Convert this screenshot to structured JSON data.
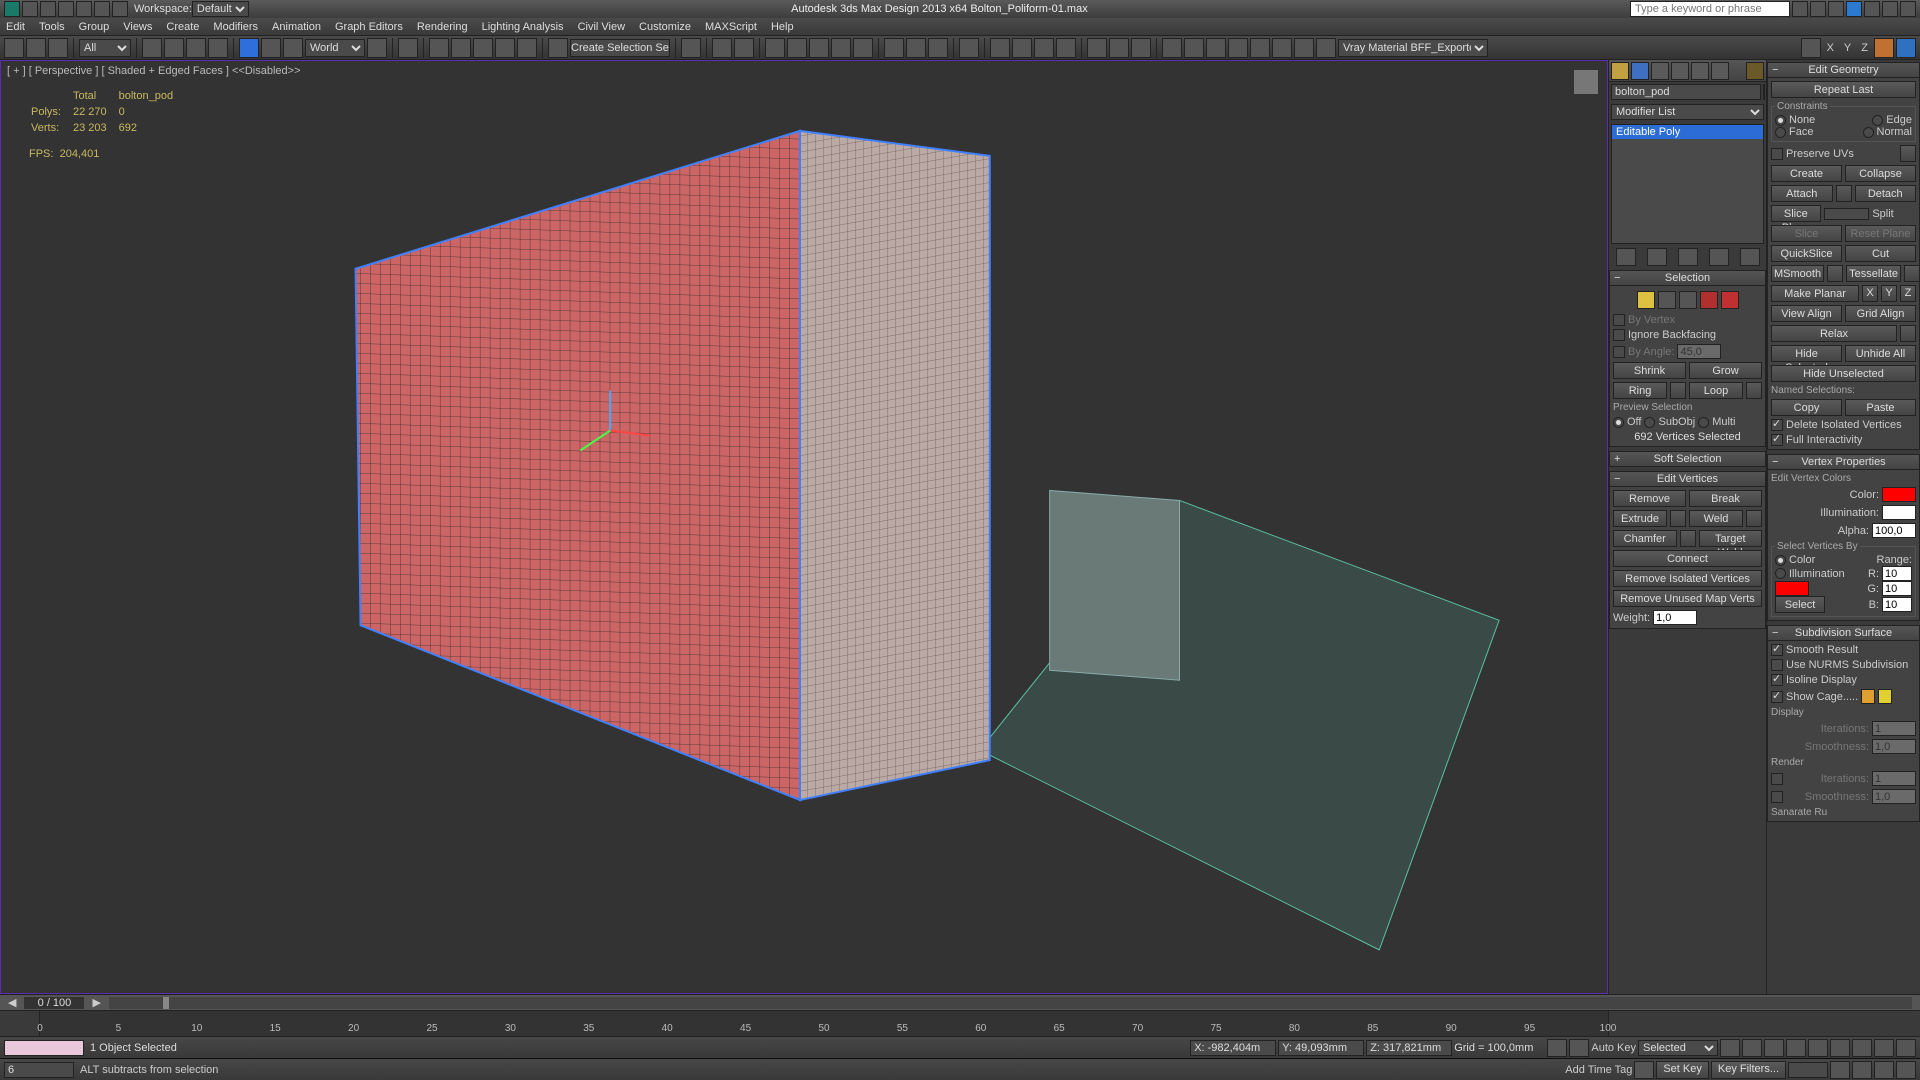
{
  "titlebar": {
    "workspace_label": "Workspace:",
    "workspace_value": "Default",
    "title": "Autodesk 3ds Max Design 2013 x64     Bolton_Poliform-01.max",
    "search_placeholder": "Type a keyword or phrase"
  },
  "menus": [
    "Edit",
    "Tools",
    "Group",
    "Views",
    "Create",
    "Modifiers",
    "Animation",
    "Graph Editors",
    "Rendering",
    "Lighting Analysis",
    "Civil View",
    "Customize",
    "MAXScript",
    "Help"
  ],
  "toolbar": {
    "filter": "All",
    "refsys": "World",
    "named_sel": "Create Selection Se",
    "material_combo": "Vray Material  BFF_Exporter",
    "axes": [
      "X",
      "Y",
      "Z"
    ]
  },
  "viewport": {
    "label": "[ + ] [ Perspective ] [ Shaded + Edged Faces ]   <<Disabled>>",
    "stats": {
      "headers": [
        "",
        "Total",
        "bolton_pod"
      ],
      "rows": [
        [
          "Polys:",
          "22 270",
          "0"
        ],
        [
          "Verts:",
          "23 203",
          "692"
        ]
      ],
      "fps_label": "FPS:",
      "fps_value": "204,401"
    }
  },
  "cmd": {
    "object_name": "bolton_pod",
    "modifier_list": "Modifier List",
    "stack_item": "Editable Poly",
    "selection": {
      "title": "Selection",
      "by_vertex": "By Vertex",
      "ignore_backfacing": "Ignore Backfacing",
      "by_angle": "By Angle:",
      "angle_value": "45,0",
      "shrink": "Shrink",
      "grow": "Grow",
      "ring": "Ring",
      "loop": "Loop",
      "preview_label": "Preview Selection",
      "off": "Off",
      "subobj": "SubObj",
      "multi": "Multi",
      "status": "692 Vertices Selected"
    },
    "soft_selection": "Soft Selection",
    "edit_vertices": {
      "title": "Edit Vertices",
      "remove": "Remove",
      "break": "Break",
      "extrude": "Extrude",
      "weld": "Weld",
      "chamfer": "Chamfer",
      "target_weld": "Target Weld",
      "connect": "Connect",
      "remove_isolated": "Remove Isolated Vertices",
      "remove_unused": "Remove Unused Map Verts",
      "weight_label": "Weight:",
      "weight_value": "1,0"
    }
  },
  "geo": {
    "title": "Edit Geometry",
    "repeat_last": "Repeat Last",
    "constraints": "Constraints",
    "c_none": "None",
    "c_edge": "Edge",
    "c_face": "Face",
    "c_normal": "Normal",
    "preserve_uvs": "Preserve UVs",
    "create": "Create",
    "collapse": "Collapse",
    "attach": "Attach",
    "detach": "Detach",
    "slice_plane": "Slice Plane",
    "split": "Split",
    "slice": "Slice",
    "reset_plane": "Reset Plane",
    "quickslice": "QuickSlice",
    "cut": "Cut",
    "msmooth": "MSmooth",
    "tessellate": "Tessellate",
    "make_planar": "Make Planar",
    "view_align": "View Align",
    "grid_align": "Grid Align",
    "relax": "Relax",
    "hide_selected": "Hide Selected",
    "unhide_all": "Unhide All",
    "hide_unselected": "Hide Unselected",
    "named_selections": "Named Selections:",
    "copy": "Copy",
    "paste": "Paste",
    "delete_isolated": "Delete Isolated Vertices",
    "full_interactivity": "Full Interactivity",
    "vertex_props": {
      "title": "Vertex Properties",
      "edit_colors": "Edit Vertex Colors",
      "color": "Color:",
      "illum": "Illumination:",
      "alpha": "Alpha:",
      "alpha_value": "100,0",
      "select_by": "Select Vertices By",
      "by_color": "Color",
      "by_illum": "Illumination",
      "range": "Range:",
      "r": "R:",
      "g": "G:",
      "b": "B:",
      "rv": "10",
      "gv": "10",
      "bv": "10",
      "select": "Select"
    },
    "subdiv": {
      "title": "Subdivision Surface",
      "smooth_result": "Smooth Result",
      "use_nurms": "Use NURMS Subdivision",
      "isoline": "Isoline Display",
      "show_cage": "Show Cage.....",
      "display": "Display",
      "iterations": "Iterations:",
      "iter_val": "1",
      "smoothness": "Smoothness:",
      "smooth_val": "1,0",
      "render": "Render",
      "r_iter_val": "1",
      "r_smooth_val": "1,0",
      "separate_by": "Sanarate Ru"
    }
  },
  "timeline": {
    "frame": "0 / 100",
    "ticks": [
      "0",
      "5",
      "10",
      "15",
      "20",
      "25",
      "30",
      "35",
      "40",
      "45",
      "50",
      "55",
      "60",
      "65",
      "70",
      "75",
      "80",
      "85",
      "90",
      "95",
      "100"
    ]
  },
  "status1": {
    "selection": "1 Object Selected",
    "x": "X: -982,404m",
    "y": "Y: 49,093mm",
    "z": "Z: 317,821mm",
    "grid": "Grid = 100,0mm",
    "autokey": "Auto Key",
    "mode": "Selected"
  },
  "status2": {
    "frame_field": "6",
    "hint": "ALT subtracts from selection",
    "add_time_tag": "Add Time Tag",
    "setkey": "Set Key",
    "keyfilters": "Key Filters..."
  }
}
